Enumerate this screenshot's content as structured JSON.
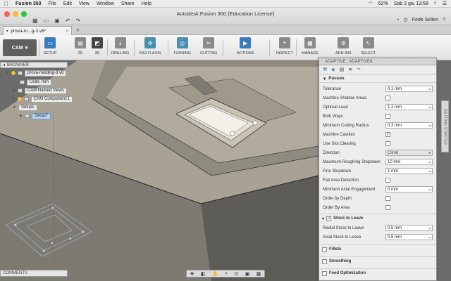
{
  "menubar": {
    "apple": "",
    "app": "Fusion 360",
    "items": [
      "File",
      "Edit",
      "View",
      "Window",
      "Share",
      "Help"
    ],
    "battery": "62%",
    "datetime": "Sab 2 giu  13:58"
  },
  "window": {
    "title": "Autodesk Fusion 360 (Education License)",
    "user": "Fede Sellen"
  },
  "doc_tab": {
    "label": "prova-m...g-3 v6*",
    "close": "×",
    "add": "+"
  },
  "ribbon": {
    "workspace": "CAM",
    "tools": [
      {
        "label": "SETUP",
        "icon": "setup-icon"
      },
      {
        "label": "2D",
        "icon": "2d-icon"
      },
      {
        "label": "3D",
        "icon": "3d-icon"
      },
      {
        "label": "DRILLING",
        "icon": "drill-icon"
      },
      {
        "label": "MULTI-AXIS",
        "icon": "multi-axis-icon"
      },
      {
        "label": "TURNING",
        "icon": "turning-icon"
      },
      {
        "label": "CUTTING",
        "icon": "cutting-icon"
      },
      {
        "label": "ACTIONS",
        "icon": "actions-icon"
      },
      {
        "label": "INSPECT",
        "icon": "inspect-icon"
      },
      {
        "label": "MANAGE",
        "icon": "manage-icon"
      },
      {
        "label": "ADD-INS",
        "icon": "addins-icon"
      },
      {
        "label": "SELECT",
        "icon": "select-icon"
      }
    ]
  },
  "browser": {
    "title": "BROWSER",
    "root": "prova-molding-3 v6",
    "units": "Units: mm",
    "named_views": "CAM Named Views",
    "component": "CAM Component:1",
    "setups": "Setups",
    "setup": "Setup7"
  },
  "comments": "COMMENTS",
  "side_tab": "GETTING STARTED",
  "panel": {
    "title": "ADAPTIVE : ADAPTIVE4",
    "passes_label": "Passes",
    "fields": [
      {
        "label": "Tolerance",
        "type": "input",
        "value": "0.1 mm"
      },
      {
        "label": "Machine Shallow Areas",
        "type": "check",
        "value": ""
      },
      {
        "label": "Optimal Load",
        "type": "input",
        "value": "1.2 mm"
      },
      {
        "label": "Both Ways",
        "type": "check",
        "value": ""
      },
      {
        "label": "Minimum Cutting Radius",
        "type": "input",
        "value": "0.3 mm"
      },
      {
        "label": "Machine Cavities",
        "type": "check",
        "value": "✓"
      },
      {
        "label": "Use Slot Clearing",
        "type": "check",
        "value": ""
      },
      {
        "label": "Direction",
        "type": "select",
        "value": "Climb"
      },
      {
        "label": "Maximum Roughing Stepdown",
        "type": "input",
        "value": "10 mm"
      },
      {
        "label": "Fine Stepdown",
        "type": "input",
        "value": "1 mm"
      },
      {
        "label": "Flat Area Detection",
        "type": "check",
        "value": ""
      },
      {
        "label": "Minimum Axial Engagement",
        "type": "input",
        "value": "0 mm"
      },
      {
        "label": "Order by Depth",
        "type": "check",
        "value": ""
      },
      {
        "label": "Order By Area",
        "type": "check",
        "value": ""
      }
    ],
    "stock_label": "Stock to Leave",
    "stock_fields": [
      {
        "label": "Radial Stock to Leave",
        "value": "0.5 mm"
      },
      {
        "label": "Axial Stock to Leave",
        "value": "0.5 mm"
      }
    ],
    "fillets_label": "Fillets",
    "smoothing_label": "Smoothing",
    "feed_label": "Feed Optimization"
  },
  "colors": {
    "accent": "#3a7bbf",
    "part": "#9b9688",
    "panel_bg": "#ededed"
  }
}
